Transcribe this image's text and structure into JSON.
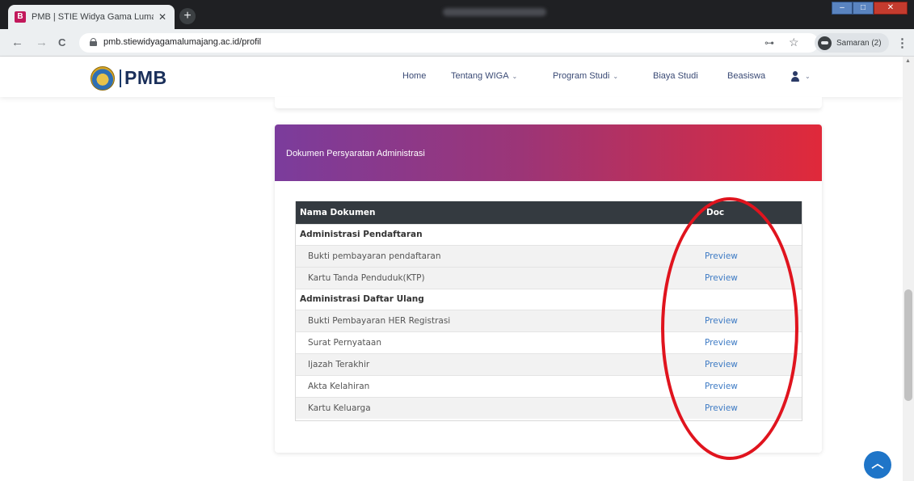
{
  "browser": {
    "tab": {
      "favicon": "B",
      "title": "PMB | STIE Widya Gama Lumajang",
      "close": "✕"
    },
    "new_tab": "+",
    "url": "pmb.stiewidyagamalumajang.ac.id/profil",
    "profile_label": "Samaran (2)",
    "nav": {
      "back": "←",
      "forward": "→",
      "reload": "C"
    },
    "menu": "⋮",
    "window_controls": {
      "minimize": "–",
      "maximize": "□",
      "close": "✕"
    }
  },
  "site": {
    "logo_text": "PMB",
    "menu": [
      {
        "label": "Home",
        "has_dropdown": false
      },
      {
        "label": "Tentang WIGA",
        "has_dropdown": true
      },
      {
        "label": "Program Studi",
        "has_dropdown": true
      },
      {
        "label": "Biaya Studi",
        "has_dropdown": false
      },
      {
        "label": "Beasiswa",
        "has_dropdown": false
      }
    ],
    "chevron": "⌄"
  },
  "card": {
    "title": "Dokumen Persyaratan Administrasi",
    "header_gradient": [
      "#7b3c9c",
      "#e0293a"
    ],
    "table": {
      "headers": [
        "Nama Dokumen",
        "Doc"
      ],
      "groups": [
        {
          "name": "Administrasi Pendaftaran",
          "rows": [
            {
              "name": "Bukti pembayaran pendaftaran",
              "link": "Preview"
            },
            {
              "name": "Kartu Tanda Penduduk(KTP)",
              "link": "Preview"
            }
          ]
        },
        {
          "name": "Administrasi Daftar Ulang",
          "rows": [
            {
              "name": "Bukti Pembayaran HER Registrasi",
              "link": "Preview"
            },
            {
              "name": "Surat Pernyataan",
              "link": "Preview"
            },
            {
              "name": "Ijazah Terakhir",
              "link": "Preview"
            },
            {
              "name": "Akta Kelahiran",
              "link": "Preview"
            },
            {
              "name": "Kartu Keluarga",
              "link": "Preview"
            }
          ]
        }
      ]
    }
  },
  "annotation_color": "#e0141e",
  "link_color": "#3e7bc4",
  "back_to_top_icon": "chevron-up-icon"
}
